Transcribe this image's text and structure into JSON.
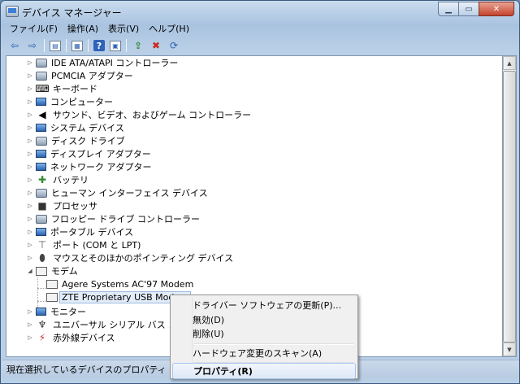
{
  "window": {
    "title": "デバイス マネージャー"
  },
  "menubar": [
    "ファイル(F)",
    "操作(A)",
    "表示(V)",
    "ヘルプ(H)"
  ],
  "toolbar": {
    "icons": [
      "back-arrow-icon",
      "forward-arrow-icon",
      "properties-window-icon",
      "view-icon",
      "help-icon",
      "show-hidden-icon",
      "update-driver-icon",
      "uninstall-icon",
      "scan-hardware-icon"
    ]
  },
  "tree": {
    "categories": [
      {
        "label": "IDE ATA/ATAPI コントローラー",
        "icon": "ide-controller-icon",
        "expanded": false
      },
      {
        "label": "PCMCIA アダプター",
        "icon": "pcmcia-icon",
        "expanded": false
      },
      {
        "label": "キーボード",
        "icon": "keyboard-icon",
        "expanded": false
      },
      {
        "label": "コンピューター",
        "icon": "computer-icon",
        "expanded": false
      },
      {
        "label": "サウンド、ビデオ、およびゲーム コントローラー",
        "icon": "speaker-icon",
        "expanded": false
      },
      {
        "label": "システム デバイス",
        "icon": "system-device-icon",
        "expanded": false
      },
      {
        "label": "ディスク ドライブ",
        "icon": "disk-drive-icon",
        "expanded": false
      },
      {
        "label": "ディスプレイ アダプター",
        "icon": "display-adapter-icon",
        "expanded": false
      },
      {
        "label": "ネットワーク アダプター",
        "icon": "network-adapter-icon",
        "expanded": false
      },
      {
        "label": "バッテリ",
        "icon": "battery-icon",
        "expanded": false
      },
      {
        "label": "ヒューマン インターフェイス デバイス",
        "icon": "hid-icon",
        "expanded": false
      },
      {
        "label": "プロセッサ",
        "icon": "processor-icon",
        "expanded": false
      },
      {
        "label": "フロッピー ドライブ コントローラー",
        "icon": "floppy-controller-icon",
        "expanded": false
      },
      {
        "label": "ポータブル デバイス",
        "icon": "portable-device-icon",
        "expanded": false
      },
      {
        "label": "ポート (COM と LPT)",
        "icon": "port-icon",
        "expanded": false
      },
      {
        "label": "マウスとそのほかのポインティング デバイス",
        "icon": "mouse-icon",
        "expanded": false
      },
      {
        "label": "モデム",
        "icon": "modem-icon",
        "expanded": true
      },
      {
        "label": "モニター",
        "icon": "monitor-icon",
        "expanded": false
      },
      {
        "label": "ユニバーサル シリアル バス コント",
        "icon": "usb-icon",
        "expanded": false
      },
      {
        "label": "赤外線デバイス",
        "icon": "infrared-icon",
        "expanded": false
      }
    ],
    "modem_children": [
      "Agere Systems AC'97 Modem",
      "ZTE Proprietary USB Modem"
    ]
  },
  "context_menu": {
    "items": [
      "ドライバー ソフトウェアの更新(P)...",
      "無効(D)",
      "削除(U)",
      "ハードウェア変更のスキャン(A)",
      "プロパティ(R)"
    ]
  },
  "statusbar": {
    "text": "現在選択しているデバイスのプロパティ シー"
  }
}
